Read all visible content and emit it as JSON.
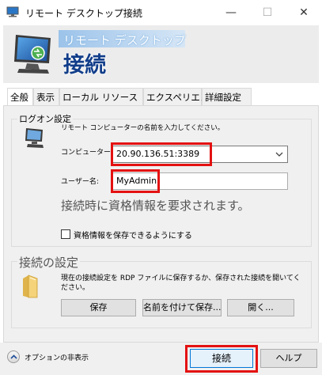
{
  "window": {
    "title": "リモート デスクトップ接続",
    "minimize_glyph": "—",
    "maximize_glyph": "☐",
    "close_glyph": "✕"
  },
  "banner": {
    "line1": "リモート デスクトップ",
    "line2": "接続"
  },
  "tabs": [
    {
      "label": "全般",
      "active": true
    },
    {
      "label": "表示"
    },
    {
      "label": "ローカル リソース"
    },
    {
      "label": "エクスペリエンス"
    },
    {
      "label": "詳細設定"
    }
  ],
  "logon": {
    "group_label": "ログオン設定",
    "instruction": "リモート コンピューターの名前を入力してください。",
    "computer_label": "コンピューター:",
    "computer_value": "20.90.136.51:3389",
    "user_label": "ユーザー名:",
    "user_value": "MyAdmin",
    "credential_note": "接続時に資格情報を要求されます。",
    "save_credentials_label": "資格情報を保存できるようにする",
    "save_credentials_checked": false
  },
  "connection_settings": {
    "group_label": "接続の設定",
    "description": "現在の接続設定を RDP ファイルに保存するか、保存された接続を開いてください。",
    "save_button": "保存",
    "save_as_button": "名前を付けて保存...",
    "open_button": "開く..."
  },
  "footer": {
    "options_label": "オプションの非表示",
    "connect_button": "接続",
    "help_button": "ヘルプ"
  },
  "colors": {
    "highlight_red": "#e41111",
    "banner_title_blue": "#123e8a"
  },
  "icons": [
    "rdp-app-icon",
    "rdp-computer-icon",
    "computer-icon",
    "folder-icon",
    "chevron-up-icon",
    "chevron-down-icon"
  ]
}
